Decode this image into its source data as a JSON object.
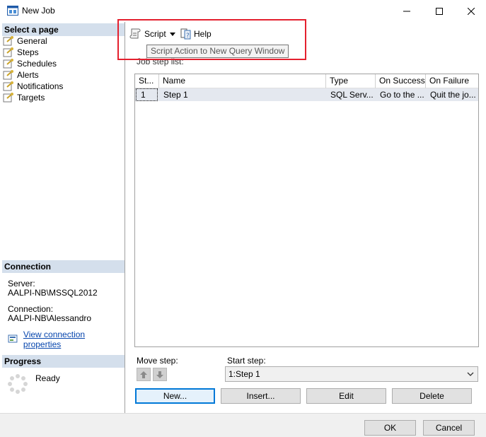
{
  "window": {
    "title": "New Job",
    "controls": {
      "minimize_icon": "minimize-icon",
      "maximize_icon": "maximize-icon",
      "close_icon": "close-icon"
    }
  },
  "sidebar": {
    "select_page_header": "Select a page",
    "pages": [
      {
        "label": "General",
        "icon": "page-wrench-icon"
      },
      {
        "label": "Steps",
        "icon": "page-wrench-icon"
      },
      {
        "label": "Schedules",
        "icon": "page-wrench-icon"
      },
      {
        "label": "Alerts",
        "icon": "page-wrench-icon"
      },
      {
        "label": "Notifications",
        "icon": "page-wrench-icon"
      },
      {
        "label": "Targets",
        "icon": "page-wrench-icon"
      }
    ],
    "connection_header": "Connection",
    "server_label": "Server:",
    "server_value": "AALPI-NB\\MSSQL2012",
    "connection_label": "Connection:",
    "connection_value": "AALPI-NB\\Alessandro",
    "view_connection_link": "View connection properties",
    "progress_header": "Progress",
    "progress_status": "Ready"
  },
  "toolbar": {
    "script_label": "Script",
    "help_label": "Help",
    "tooltip": "Script Action to New Query Window"
  },
  "main": {
    "job_step_list_label": "Job step list:",
    "columns": [
      "St...",
      "Name",
      "Type",
      "On Success",
      "On Failure"
    ],
    "rows": [
      [
        "1",
        "Step 1",
        "SQL Serv...",
        "Go to the ...",
        "Quit the jo..."
      ]
    ],
    "move_step_label": "Move step:",
    "start_step_label": "Start step:",
    "start_step_value": "1:Step 1",
    "buttons": {
      "new": "New...",
      "insert": "Insert...",
      "edit": "Edit",
      "delete": "Delete"
    }
  },
  "footer": {
    "ok": "OK",
    "cancel": "Cancel"
  },
  "colors": {
    "highlight": "#e4202e",
    "section_header": "#d4dfec",
    "link": "#0645ad",
    "selected_row": "#e4e8ef"
  }
}
